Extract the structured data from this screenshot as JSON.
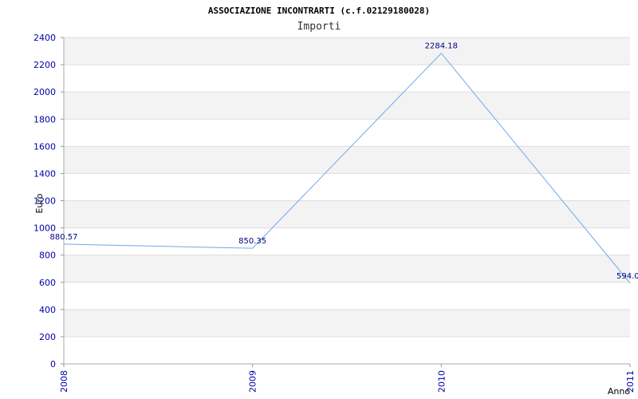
{
  "chart_data": {
    "type": "line",
    "title": "ASSOCIAZIONE INCONTRARTI (c.f.02129180028)",
    "subtitle": "Importi",
    "xlabel": "Anno",
    "ylabel": "Euro",
    "categories": [
      "2008",
      "2009",
      "2010",
      "2011"
    ],
    "series": [
      {
        "values": [
          880.57,
          850.35,
          2284.18,
          594.0
        ],
        "labels": [
          "880.57",
          "850.35",
          "2284.18",
          "594.0"
        ]
      }
    ],
    "ylim": [
      0,
      2400
    ],
    "yticks": [
      "0",
      "200",
      "400",
      "600",
      "800",
      "1000",
      "1200",
      "1400",
      "1600",
      "1800",
      "2000",
      "2200",
      "2400"
    ],
    "grid": "horizontal bands",
    "legend": "none",
    "colors": {
      "line": "#6fa8e8",
      "band": "#f3f3f3",
      "tick_text": "#0000aa"
    }
  }
}
